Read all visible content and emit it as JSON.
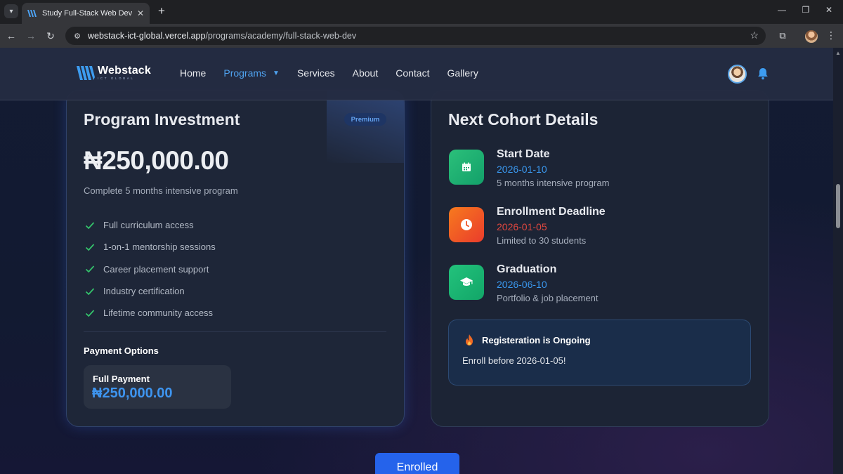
{
  "browser": {
    "tab_title": "Study Full-Stack Web Development",
    "url_host": "webstack-ict-global.vercel.app",
    "url_path": "/programs/academy/full-stack-web-dev"
  },
  "site": {
    "logo_name": "Webstack",
    "logo_tagline": "ICT GLOBAL",
    "nav": [
      "Home",
      "Programs",
      "Services",
      "About",
      "Contact",
      "Gallery"
    ],
    "active_nav": "Programs",
    "accent_color": "#4fa3f0"
  },
  "investment": {
    "title": "Program Investment",
    "badge": "Premium",
    "price": "₦250,000.00",
    "subtitle": "Complete 5 months intensive program",
    "features": [
      "Full curriculum access",
      "1-on-1 mentorship sessions",
      "Career placement support",
      "Industry certification",
      "Lifetime community access"
    ],
    "payment_title": "Payment Options",
    "payment_label": "Full Payment",
    "payment_amount": "₦250,000.00"
  },
  "cohort": {
    "title": "Next Cohort Details",
    "items": [
      {
        "title": "Start Date",
        "date": "2026-01-10",
        "note": "5 months intensive program",
        "icon": "calendar-icon",
        "color": "#22b573"
      },
      {
        "title": "Enrollment Deadline",
        "date": "2026-01-05",
        "note": "Limited to 30 students",
        "icon": "clock-icon",
        "color": "#f0542a"
      },
      {
        "title": "Graduation",
        "date": "2026-06-10",
        "note": "Portfolio & job placement",
        "icon": "graduation-cap-icon",
        "color": "#1fb86f"
      }
    ],
    "alert_title": "Registeration is Ongoing",
    "alert_text": "Enroll before 2026-01-05!",
    "alert_icon": "fire-icon"
  },
  "cta": {
    "label": "Enrolled"
  }
}
